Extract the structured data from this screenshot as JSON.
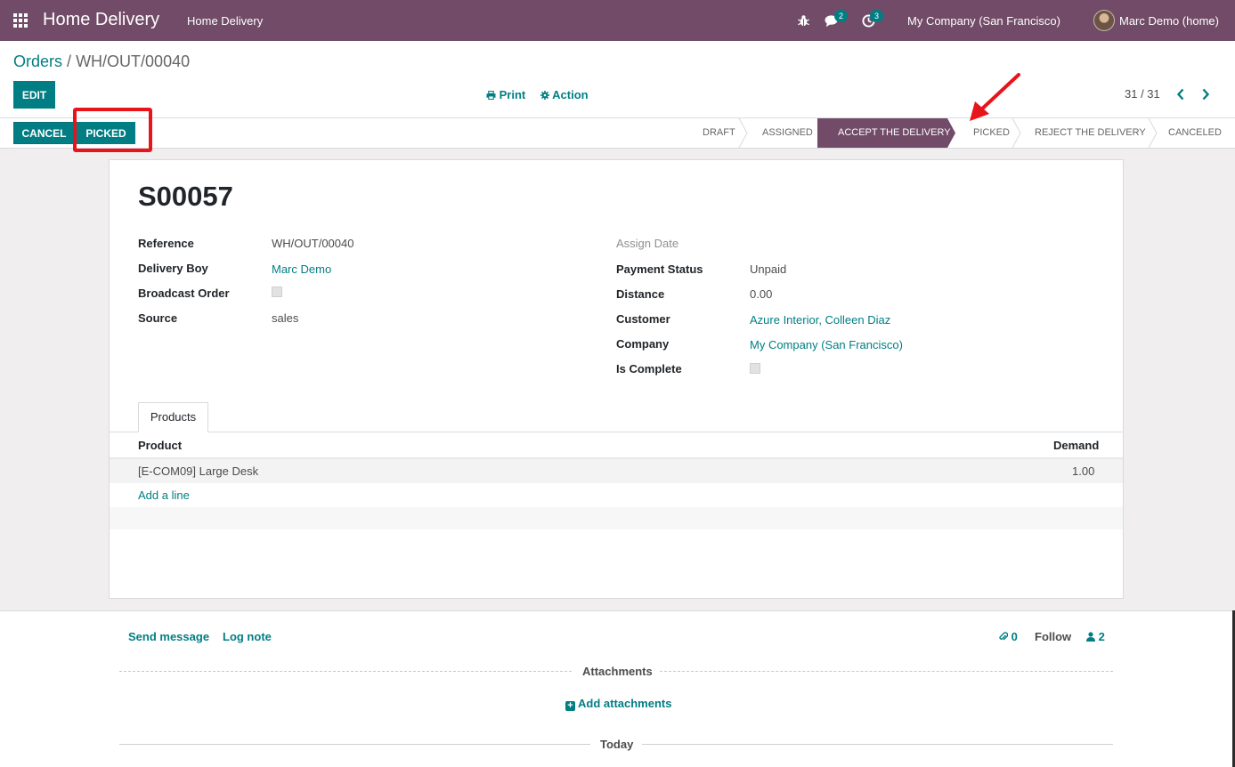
{
  "navbar": {
    "brand": "Home Delivery",
    "menu": "Home Delivery",
    "messages_badge": "2",
    "activities_badge": "3",
    "company": "My Company (San Francisco)",
    "user": "Marc Demo (home)"
  },
  "breadcrumb": {
    "parent": "Orders",
    "separator": "/",
    "current": "WH/OUT/00040"
  },
  "control": {
    "edit_label": "EDIT",
    "print_label": "Print",
    "action_label": "Action",
    "pager": "31 / 31"
  },
  "statusbar": {
    "cancel_label": "CANCEL",
    "picked_label": "PICKED",
    "stages": [
      "DRAFT",
      "ASSIGNED",
      "ACCEPT THE DELIVERY",
      "PICKED",
      "REJECT THE DELIVERY",
      "CANCELED"
    ],
    "active_stage": "ACCEPT THE DELIVERY"
  },
  "form": {
    "title": "S00057",
    "left": {
      "reference_label": "Reference",
      "reference_value": "WH/OUT/00040",
      "delivery_boy_label": "Delivery Boy",
      "delivery_boy_value": "Marc Demo",
      "broadcast_label": "Broadcast Order",
      "broadcast_checked": false,
      "source_label": "Source",
      "source_value": "sales"
    },
    "right": {
      "assign_date_label": "Assign Date",
      "payment_status_label": "Payment Status",
      "payment_status_value": "Unpaid",
      "distance_label": "Distance",
      "distance_value": "0.00",
      "customer_label": "Customer",
      "customer_value": "Azure Interior, Colleen Diaz",
      "company_label": "Company",
      "company_value": "My Company (San Francisco)",
      "is_complete_label": "Is Complete",
      "is_complete_checked": false
    },
    "tab_label": "Products",
    "table": {
      "col_product": "Product",
      "col_demand": "Demand",
      "rows": [
        {
          "product": "[E-COM09] Large Desk",
          "demand": "1.00"
        }
      ],
      "add_line": "Add a line"
    }
  },
  "chatter": {
    "send_message": "Send message",
    "log_note": "Log note",
    "attachments_count": "0",
    "follow": "Follow",
    "followers_count": "2",
    "attachments_title": "Attachments",
    "add_attachments": "Add attachments",
    "today": "Today"
  },
  "colors": {
    "navbar": "#714b67",
    "primary": "#017e84",
    "highlight": "#e8141b"
  }
}
